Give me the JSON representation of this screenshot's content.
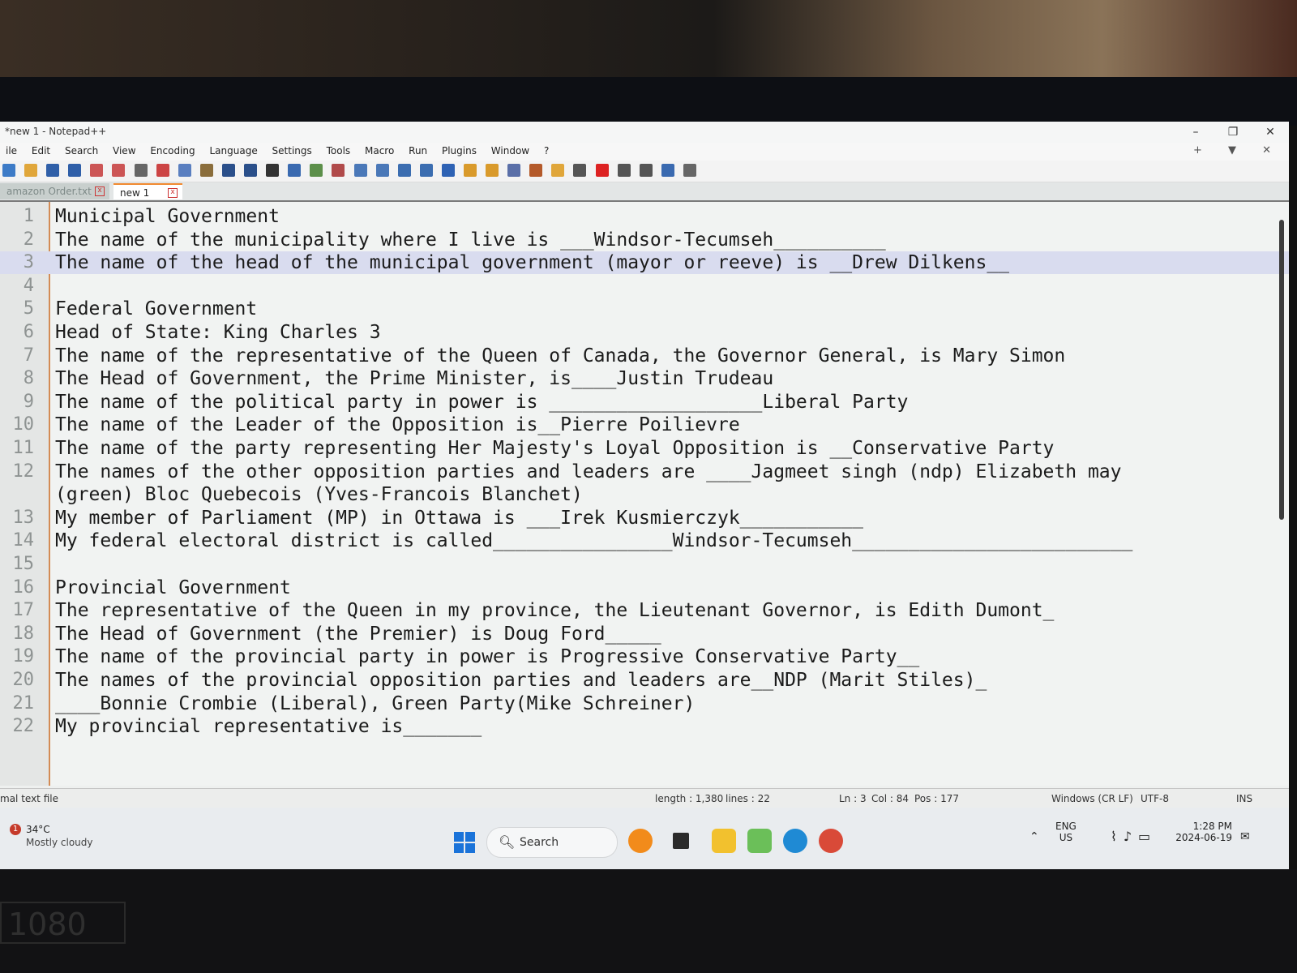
{
  "window": {
    "title": "*new 1 - Notepad++",
    "controls": [
      "–",
      "❐",
      "✕"
    ]
  },
  "menu": [
    "ile",
    "Edit",
    "Search",
    "View",
    "Encoding",
    "Language",
    "Settings",
    "Tools",
    "Macro",
    "Run",
    "Plugins",
    "Window",
    "?"
  ],
  "menu_right": "+ ▼ ✕",
  "tabs": [
    {
      "label": "amazon Order.txt"
    },
    {
      "label": "new 1"
    }
  ],
  "lines": [
    {
      "n": "1",
      "text": "Municipal Government"
    },
    {
      "n": "2",
      "text": "The name of the municipality where I live is ___Windsor-Tecumseh__________"
    },
    {
      "n": "3",
      "text": "The name of the head of the municipal government (mayor or reeve) is __Drew Dilkens__"
    },
    {
      "n": "4",
      "text": ""
    },
    {
      "n": "5",
      "text": "Federal Government"
    },
    {
      "n": "6",
      "text": "Head of State: King Charles 3"
    },
    {
      "n": "7",
      "text": "The name of the representative of the Queen of Canada, the Governor General, is Mary Simon"
    },
    {
      "n": "8",
      "text": "The Head of Government, the Prime Minister, is____Justin Trudeau"
    },
    {
      "n": "9",
      "text": "The name of the political party in power is ___________________Liberal Party"
    },
    {
      "n": "10",
      "text": "The name of the Leader of the Opposition is__Pierre Poilievre"
    },
    {
      "n": "11",
      "text": "The name of the party representing Her Majesty's Loyal Opposition is __Conservative Party"
    },
    {
      "n": "12",
      "text": "The names of the other opposition parties and leaders are ____Jagmeet singh (ndp) Elizabeth may"
    },
    {
      "n": "",
      "text": "(green) Bloc Quebecois (Yves-Francois Blanchet)"
    },
    {
      "n": "13",
      "text": "My member of Parliament (MP) in Ottawa is ___Irek Kusmierczyk___________"
    },
    {
      "n": "14",
      "text": "My federal electoral district is called________________Windsor-Tecumseh_________________________"
    },
    {
      "n": "15",
      "text": ""
    },
    {
      "n": "16",
      "text": "Provincial Government"
    },
    {
      "n": "17",
      "text": "The representative of the Queen in my province, the Lieutenant Governor, is Edith Dumont_"
    },
    {
      "n": "18",
      "text": "The Head of Government (the Premier) is Doug Ford_____"
    },
    {
      "n": "19",
      "text": "The name of the provincial party in power is Progressive Conservative Party__"
    },
    {
      "n": "20",
      "text": "The names of the provincial opposition parties and leaders are__NDP (Marit Stiles)_"
    },
    {
      "n": "21",
      "text": "____Bonnie Crombie (Liberal), Green Party(Mike Schreiner)"
    },
    {
      "n": "22",
      "text": "My provincial representative is_______"
    }
  ],
  "current_line_index": 2,
  "status": {
    "file_type": "mal text file",
    "length": "length : 1,380",
    "lines": "lines : 22",
    "ln": "Ln : 3",
    "col": "Col : 84",
    "pos": "Pos : 177",
    "eol": "Windows (CR LF)",
    "encoding": "UTF-8",
    "mode": "INS"
  },
  "taskbar": {
    "weather_alert": "1",
    "temperature": "34°C",
    "weather": "Mostly cloudy",
    "search_label": "Search",
    "lang_top": "ENG",
    "lang_bottom": "US",
    "time": "1:28 PM",
    "date": "2024-06-19"
  },
  "backdrop_label": "1080",
  "colors": {
    "accent": "#f08a30",
    "current_line": "#d9dcef",
    "gutter_border": "#d38b55"
  }
}
